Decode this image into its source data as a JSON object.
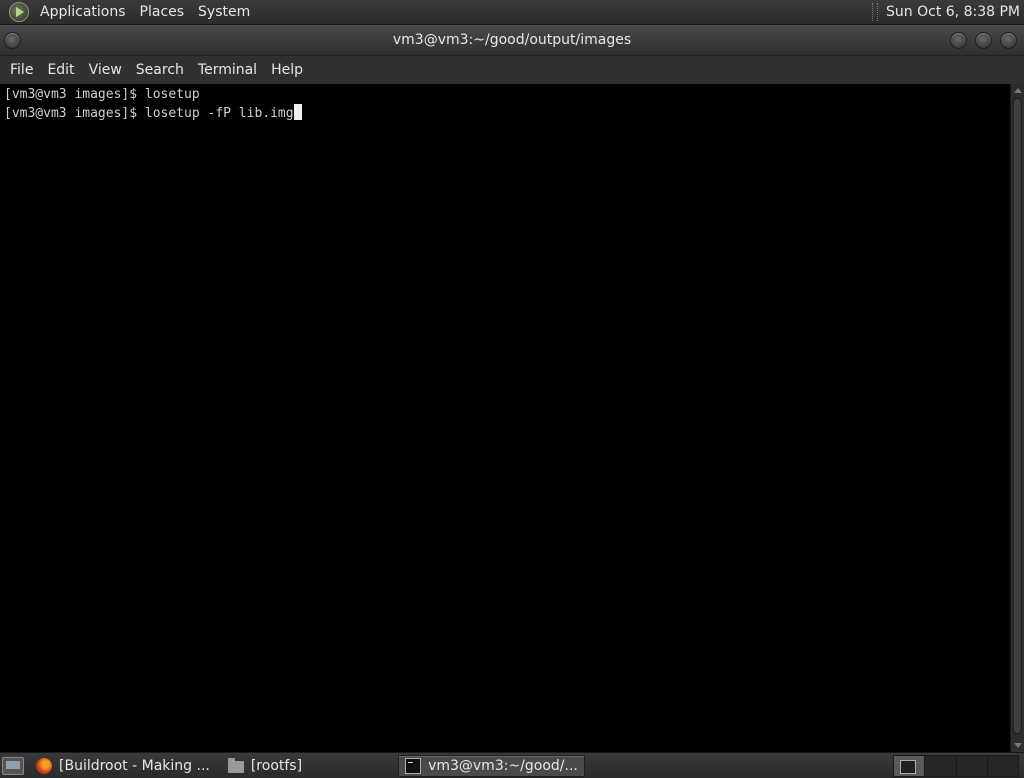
{
  "top_panel": {
    "menu": [
      "Applications",
      "Places",
      "System"
    ],
    "clock": "Sun Oct  6,  8:38 PM"
  },
  "window": {
    "title": "vm3@vm3:~/good/output/images",
    "menu": [
      "File",
      "Edit",
      "View",
      "Search",
      "Terminal",
      "Help"
    ]
  },
  "terminal": {
    "lines": [
      "[vm3@vm3 images]$ losetup",
      "[vm3@vm3 images]$ losetup -fP lib.img"
    ]
  },
  "taskbar": {
    "tasks": [
      {
        "label": "[Buildroot - Making ...",
        "icon": "firefox-icon"
      },
      {
        "label": "[rootfs]",
        "icon": "folder-icon"
      },
      {
        "label": "vm3@vm3:~/good/...",
        "icon": "terminal-icon"
      }
    ]
  },
  "colors": {
    "terminal_bg": "#000000",
    "terminal_fg": "#d0d0d0",
    "panel_bg": "#2c2c2c"
  }
}
